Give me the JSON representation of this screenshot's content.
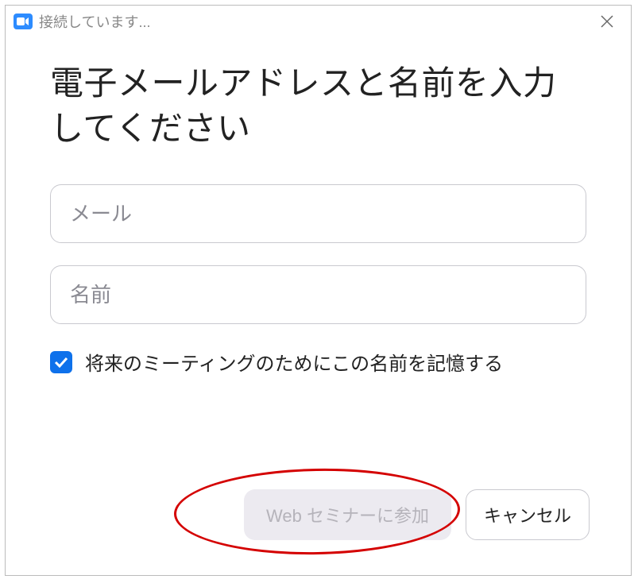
{
  "titlebar": {
    "status_text": "接続しています...",
    "app_icon_name": "zoom-icon"
  },
  "heading": "電子メールアドレスと名前を入力してください",
  "fields": {
    "email": {
      "placeholder": "メール",
      "value": ""
    },
    "name": {
      "placeholder": "名前",
      "value": ""
    }
  },
  "remember": {
    "checked": true,
    "label": "将来のミーティングのためにこの名前を記憶する"
  },
  "buttons": {
    "join": "Web セミナーに参加",
    "cancel": "キャンセル"
  }
}
